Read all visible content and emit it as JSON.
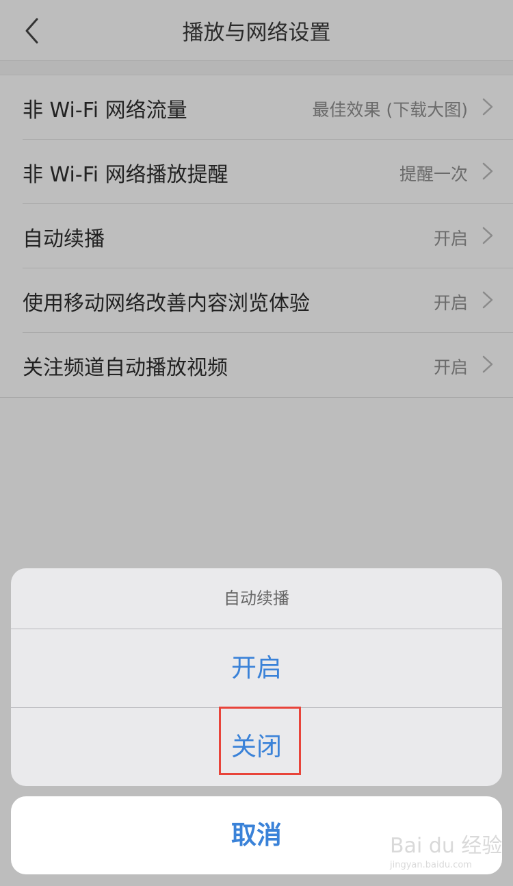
{
  "header": {
    "title": "播放与网络设置"
  },
  "settings": [
    {
      "label": "非 Wi-Fi 网络流量",
      "value": "最佳效果 (下载大图)"
    },
    {
      "label": "非 Wi-Fi 网络播放提醒",
      "value": "提醒一次"
    },
    {
      "label": "自动续播",
      "value": "开启"
    },
    {
      "label": "使用移动网络改善内容浏览体验",
      "value": "开启"
    },
    {
      "label": "关注频道自动播放视频",
      "value": "开启"
    }
  ],
  "action_sheet": {
    "title": "自动续播",
    "option_on": "开启",
    "option_off": "关闭",
    "cancel": "取消"
  },
  "watermark": {
    "text": "Bai du 经验",
    "sub": "jingyan.baidu.com"
  },
  "colors": {
    "accent": "#3a82d8",
    "highlight": "#e8443a"
  }
}
